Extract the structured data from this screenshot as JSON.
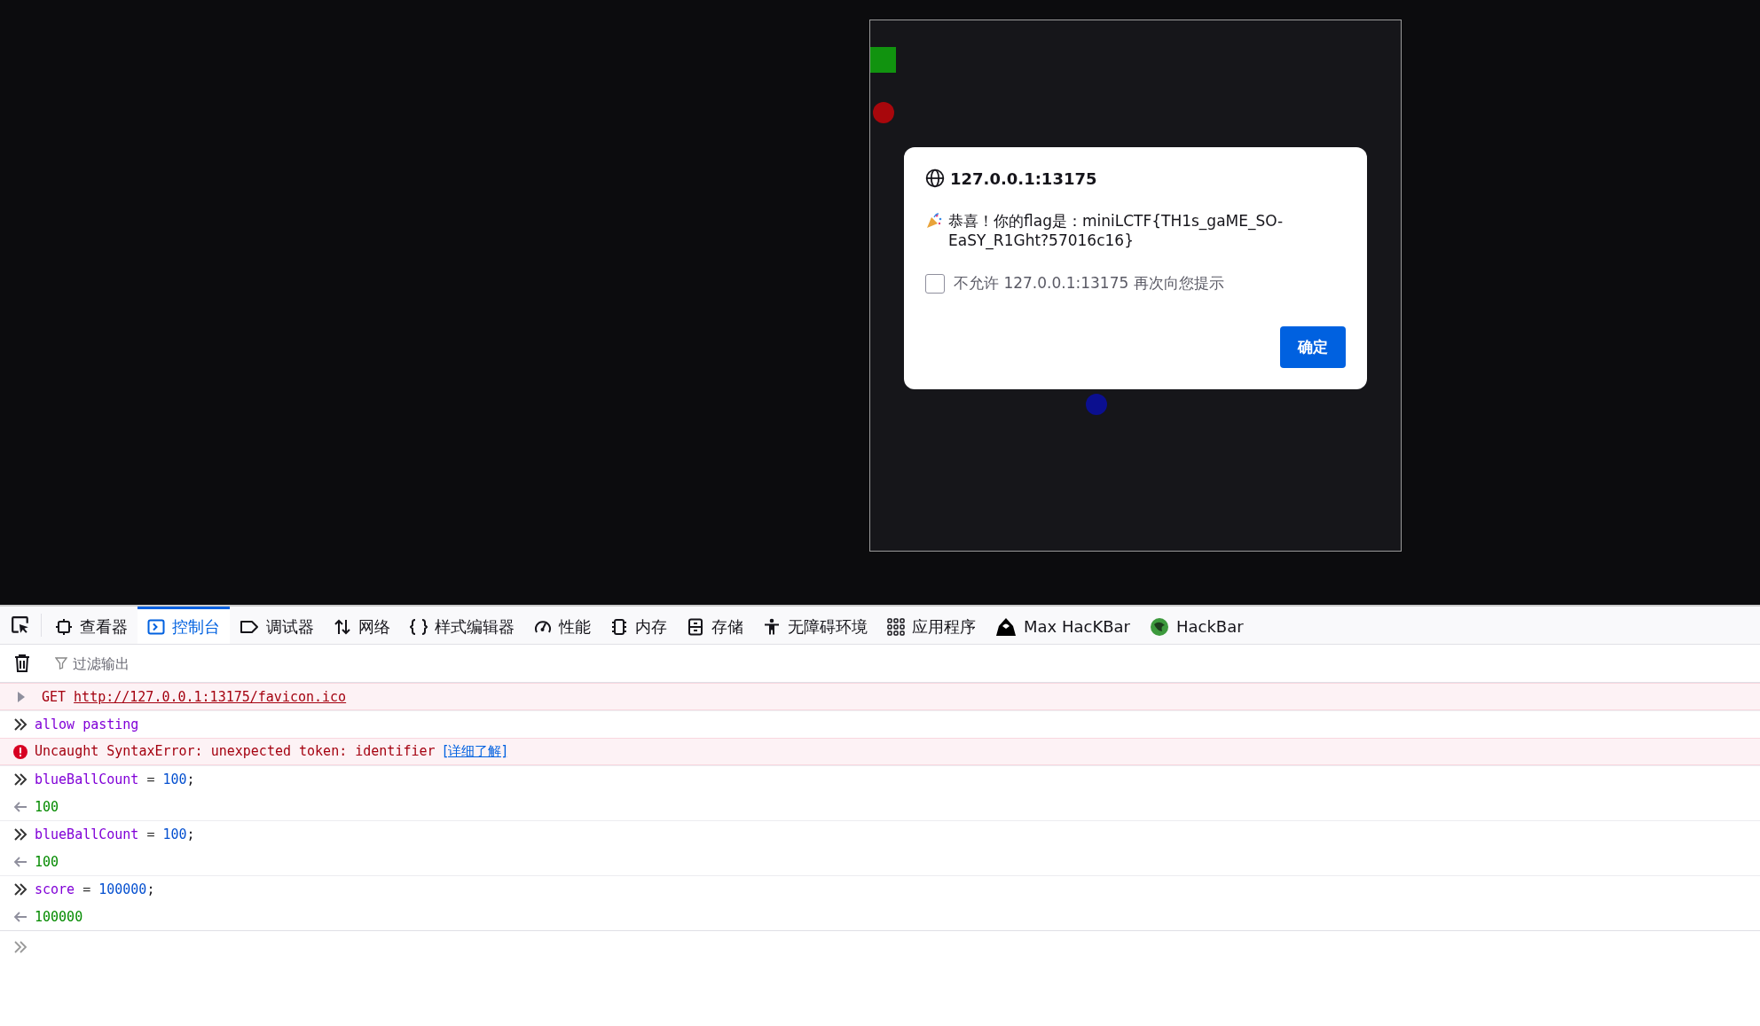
{
  "dialog": {
    "title": "127.0.0.1:13175",
    "message": "恭喜！你的flag是：miniLCTF{TH1s_gaME_SO-EaSY_R1Ght?57016c16}",
    "checkbox": {
      "label": "不允许 127.0.0.1:13175 再次向您提示",
      "checked": false
    },
    "button": "确定"
  },
  "devtools": {
    "tabs": [
      {
        "kind": "inspector",
        "label": "查看器",
        "selected": false
      },
      {
        "kind": "console",
        "label": "控制台",
        "selected": true
      },
      {
        "kind": "debugger",
        "label": "调试器",
        "selected": false
      },
      {
        "kind": "network",
        "label": "网络",
        "selected": false
      },
      {
        "kind": "style",
        "label": "样式编辑器",
        "selected": false
      },
      {
        "kind": "performance",
        "label": "性能",
        "selected": false
      },
      {
        "kind": "memory",
        "label": "内存",
        "selected": false
      },
      {
        "kind": "storage",
        "label": "存储",
        "selected": false
      },
      {
        "kind": "accessibility",
        "label": "无障碍环境",
        "selected": false
      },
      {
        "kind": "application",
        "label": "应用程序",
        "selected": false
      },
      {
        "kind": "maxhackbar",
        "label": "Max HacKBar",
        "selected": false
      },
      {
        "kind": "hackbar",
        "label": "HackBar",
        "selected": false
      }
    ],
    "filter": {
      "placeholder": "过滤输出"
    },
    "console": [
      {
        "kind": "network",
        "method": "GET",
        "url": "http://127.0.0.1:13175/favicon.ico"
      },
      {
        "kind": "input",
        "target": "allow pasting"
      },
      {
        "kind": "error",
        "message": "Uncaught SyntaxError: unexpected token: identifier",
        "link": "[详细了解]"
      },
      {
        "kind": "input",
        "target": "blueBallCount",
        "operator": "=",
        "value": "100",
        "end": ";"
      },
      {
        "kind": "output",
        "value": "100"
      },
      {
        "kind": "input",
        "target": "blueBallCount",
        "operator": "=",
        "value": "100",
        "end": ";"
      },
      {
        "kind": "output",
        "value": "100"
      },
      {
        "kind": "input",
        "target": "score",
        "operator": "=",
        "value": "100000",
        "end": ";"
      },
      {
        "kind": "output",
        "value": "100000"
      }
    ]
  }
}
